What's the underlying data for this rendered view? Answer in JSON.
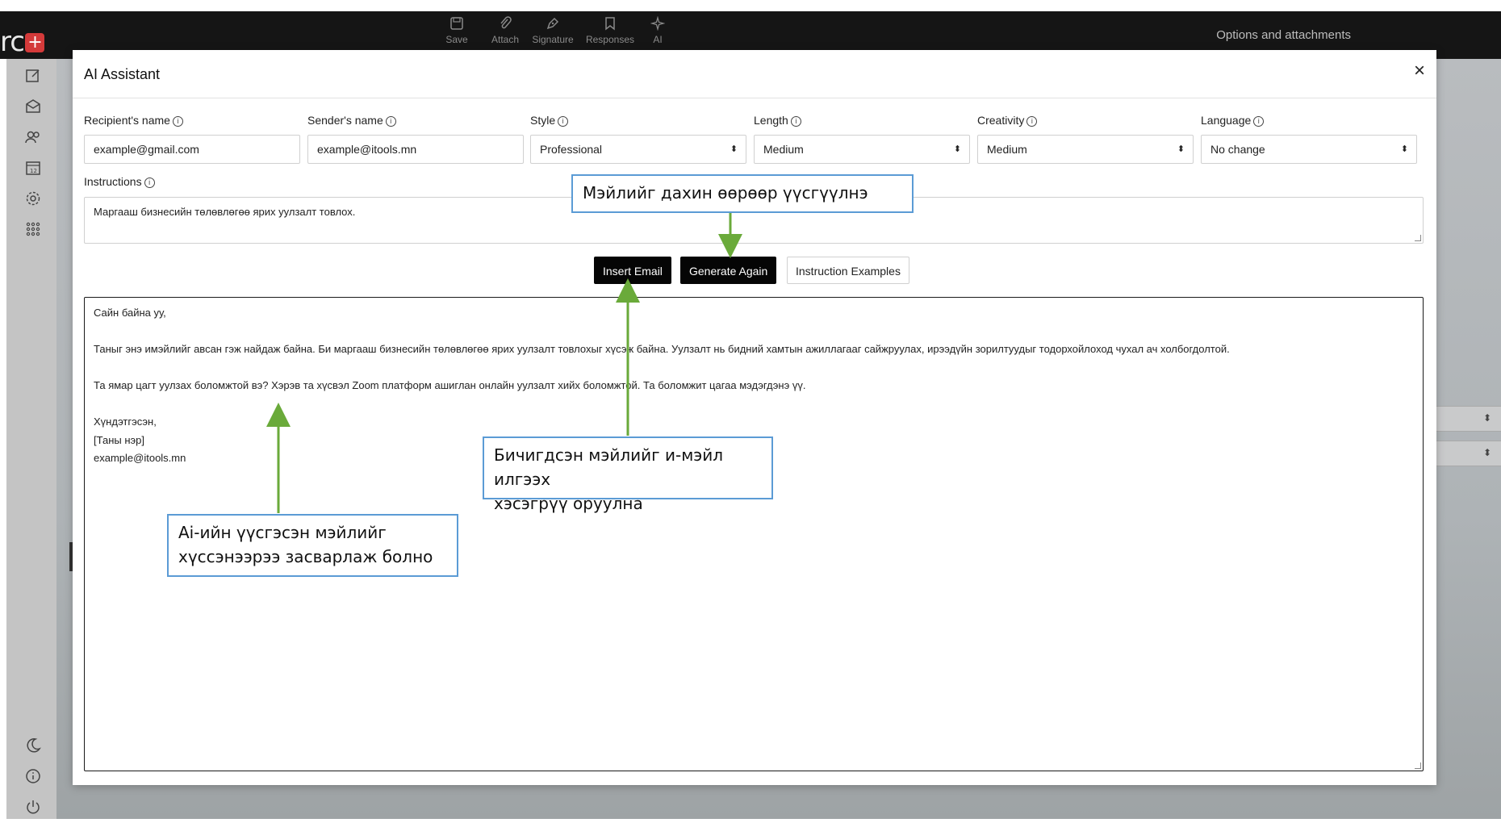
{
  "app": {
    "logo_text": "rc",
    "logo_badge": "+",
    "options_label": "Options and attachments"
  },
  "toolbar": {
    "items": [
      {
        "label": "Save",
        "icon": "save-icon"
      },
      {
        "label": "Attach",
        "icon": "paperclip-icon"
      },
      {
        "label": "Signature",
        "icon": "pen-icon"
      },
      {
        "label": "Responses",
        "icon": "bookmark-icon"
      },
      {
        "label": "AI",
        "icon": "sparkle-icon"
      }
    ]
  },
  "sidebar": {
    "icons": [
      "compose-icon",
      "inbox-icon",
      "contacts-icon",
      "calendar-icon",
      "settings-icon",
      "apps-grid-icon",
      "dark-mode-icon",
      "info-icon",
      "power-icon"
    ]
  },
  "modal": {
    "title": "AI Assistant",
    "close_label": "×",
    "fields": {
      "recipient": {
        "label": "Recipient's name",
        "value": "example@gmail.com"
      },
      "sender": {
        "label": "Sender's name",
        "value": "example@itools.mn"
      },
      "style": {
        "label": "Style",
        "value": "Professional"
      },
      "length": {
        "label": "Length",
        "value": "Medium"
      },
      "creativity": {
        "label": "Creativity",
        "value": "Medium"
      },
      "language": {
        "label": "Language",
        "value": "No change"
      }
    },
    "instructions": {
      "label": "Instructions",
      "value": "Маргааш бизнесийн төлөвлөгөө ярих уулзалт товлох."
    },
    "buttons": {
      "insert": "Insert Email",
      "generate": "Generate Again",
      "examples": "Instruction Examples"
    },
    "email_body": [
      "Сайн байна уу,",
      "",
      "Таныг энэ имэйлийг авсан гэж найдаж байна. Би маргааш бизнесийн төлөвлөгөө ярих уулзалт товлохыг хүсэж байна. Уулзалт нь бидний хамтын ажиллагааг сайжруулах, ирээдүйн зорилтуудыг тодорхойлоход чухал ач холбогдолтой.",
      "",
      "Та ямар цагт уулзах боломжтой вэ? Хэрэв та хүсвэл Zoom платформ ашиглан онлайн уулзалт хийх боломжтой. Та боломжит цагаа мэдэгдэнэ үү.",
      "",
      "Хүндэтгэсэн,",
      "[Таны нэр]",
      "example@itools.mn"
    ]
  },
  "annotations": {
    "regenerate": "Мэйлийг дахин өөрөөр үүсгүүлнэ",
    "insert_line1": "Бичигдсэн мэйлийг и-мэйл илгээх",
    "insert_line2": "хэсэгрүү оруулна",
    "edit_line1": "Ai-ийн үүсгэсэн мэйлийг",
    "edit_line2": "хүссэнээрээ засварлаж болно",
    "arrow_color": "#6aaa3a",
    "box_color": "#5b9bd5"
  },
  "colors": {
    "topbar": "#151515",
    "button_dark": "#050505",
    "accent_red": "#d43a3a"
  }
}
